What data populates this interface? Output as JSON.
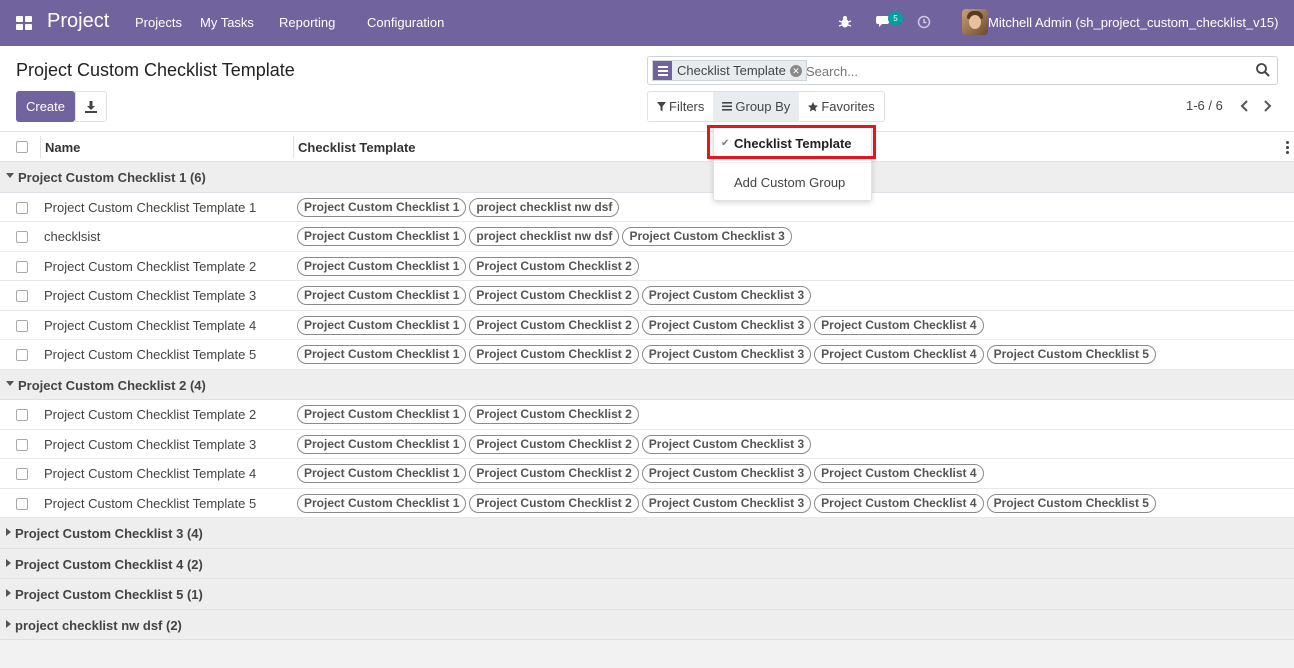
{
  "navbar": {
    "brand": "Project",
    "menu": [
      "Projects",
      "My Tasks",
      "Reporting",
      "Configuration"
    ],
    "chat_count": "5",
    "user": "Mitchell Admin (sh_project_custom_checklist_v15)"
  },
  "control_panel": {
    "title": "Project Custom Checklist Template",
    "create_label": "Create",
    "facet_value": "Checklist Template",
    "search_placeholder": "Search...",
    "filters_label": "Filters",
    "groupby_label": "Group By",
    "favorites_label": "Favorites",
    "pager": "1-6 / 6"
  },
  "dropdown": {
    "selected": "Checklist Template",
    "custom": "Add Custom Group"
  },
  "list": {
    "columns": [
      "Name",
      "Checklist Template"
    ],
    "groups": [
      {
        "label": "Project Custom Checklist 1 (6)",
        "open": true,
        "rows": [
          {
            "name": "Project Custom Checklist Template 1",
            "tags": [
              "Project Custom Checklist 1",
              "project checklist nw dsf"
            ]
          },
          {
            "name": "checklsist",
            "tags": [
              "Project Custom Checklist 1",
              "project checklist nw dsf",
              "Project Custom Checklist 3"
            ]
          },
          {
            "name": "Project Custom Checklist Template 2",
            "tags": [
              "Project Custom Checklist 1",
              "Project Custom Checklist 2"
            ]
          },
          {
            "name": "Project Custom Checklist Template 3",
            "tags": [
              "Project Custom Checklist 1",
              "Project Custom Checklist 2",
              "Project Custom Checklist 3"
            ]
          },
          {
            "name": "Project Custom Checklist Template 4",
            "tags": [
              "Project Custom Checklist 1",
              "Project Custom Checklist 2",
              "Project Custom Checklist 3",
              "Project Custom Checklist 4"
            ]
          },
          {
            "name": "Project Custom Checklist Template 5",
            "tags": [
              "Project Custom Checklist 1",
              "Project Custom Checklist 2",
              "Project Custom Checklist 3",
              "Project Custom Checklist 4",
              "Project Custom Checklist 5"
            ]
          }
        ]
      },
      {
        "label": "Project Custom Checklist 2 (4)",
        "open": true,
        "rows": [
          {
            "name": "Project Custom Checklist Template 2",
            "tags": [
              "Project Custom Checklist 1",
              "Project Custom Checklist 2"
            ]
          },
          {
            "name": "Project Custom Checklist Template 3",
            "tags": [
              "Project Custom Checklist 1",
              "Project Custom Checklist 2",
              "Project Custom Checklist 3"
            ]
          },
          {
            "name": "Project Custom Checklist Template 4",
            "tags": [
              "Project Custom Checklist 1",
              "Project Custom Checklist 2",
              "Project Custom Checklist 3",
              "Project Custom Checklist 4"
            ]
          },
          {
            "name": "Project Custom Checklist Template 5",
            "tags": [
              "Project Custom Checklist 1",
              "Project Custom Checklist 2",
              "Project Custom Checklist 3",
              "Project Custom Checklist 4",
              "Project Custom Checklist 5"
            ]
          }
        ]
      },
      {
        "label": "Project Custom Checklist 3 (4)",
        "open": false,
        "rows": []
      },
      {
        "label": "Project Custom Checklist 4 (2)",
        "open": false,
        "rows": []
      },
      {
        "label": "Project Custom Checklist 5 (1)",
        "open": false,
        "rows": []
      },
      {
        "label": "project checklist nw dsf (2)",
        "open": false,
        "rows": []
      }
    ]
  },
  "colors": {
    "brand": "#71639e",
    "highlight": "#e8141c",
    "badge": "#00a09d"
  }
}
